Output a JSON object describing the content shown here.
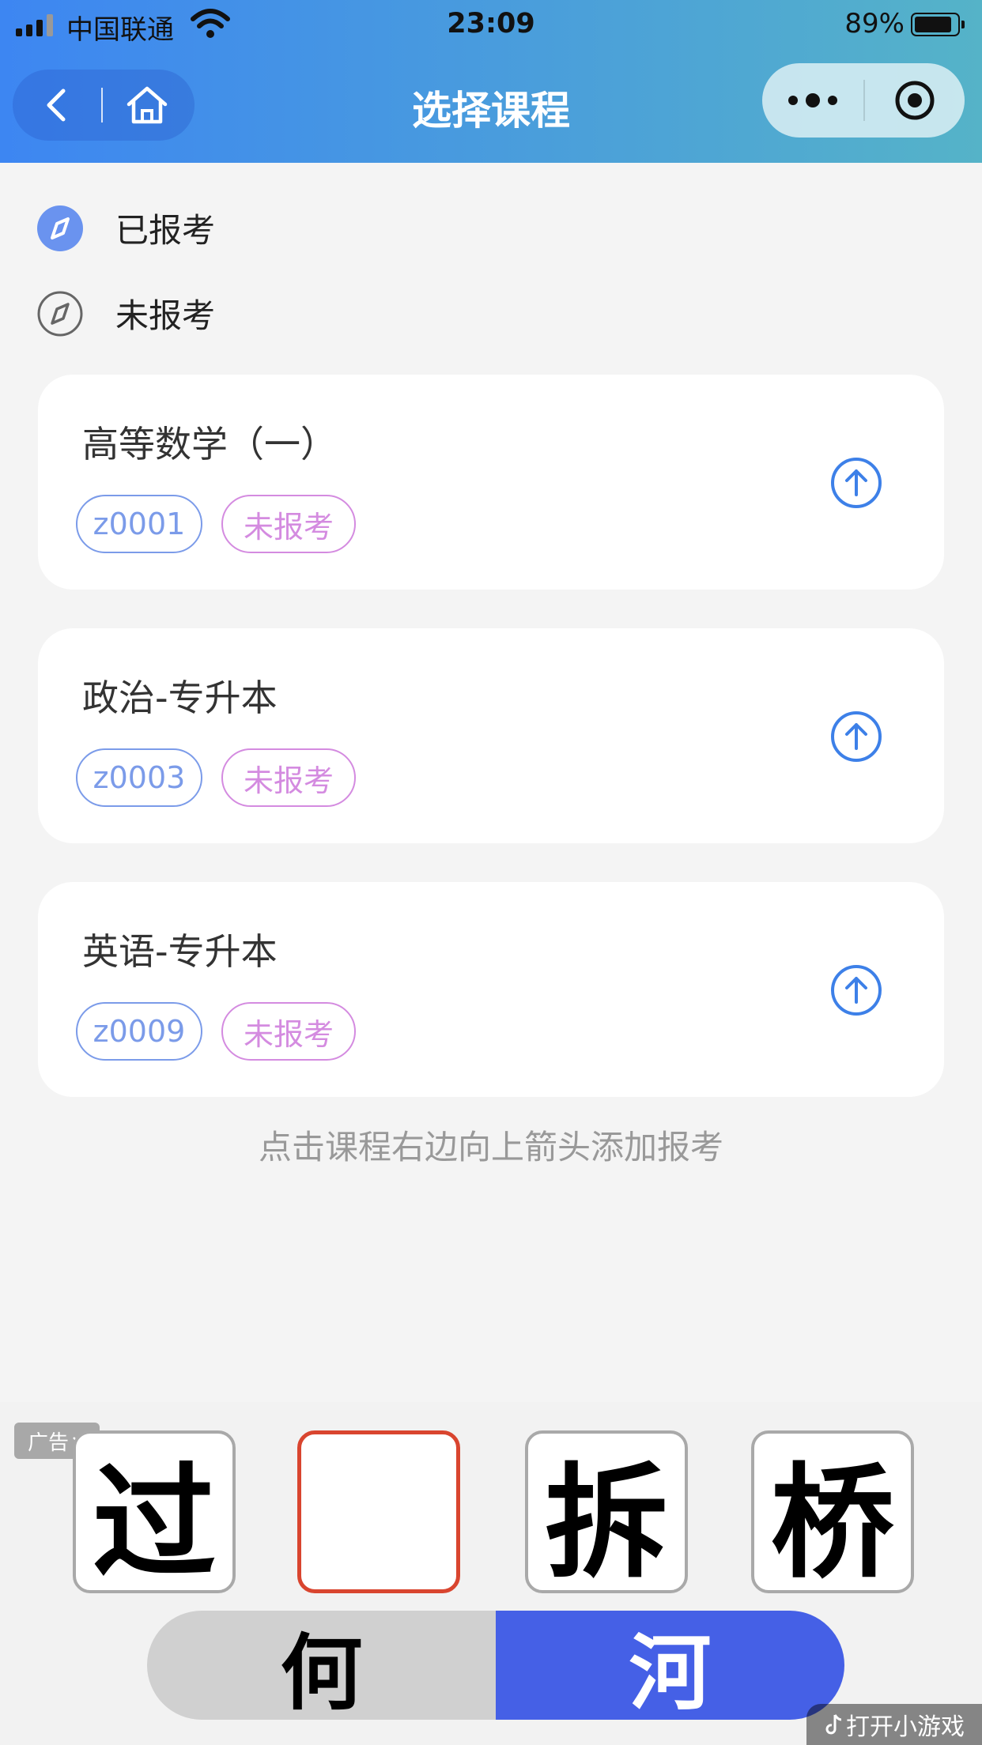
{
  "status_bar": {
    "carrier": "中国联通",
    "time": "23:09",
    "battery_percent": "89%",
    "battery_level": 0.89
  },
  "header": {
    "title": "选择课程"
  },
  "legend": {
    "registered": "已报考",
    "unregistered": "未报考"
  },
  "courses": [
    {
      "name": "高等数学（一）",
      "code": "z0001",
      "status": "未报考"
    },
    {
      "name": "政治-专升本",
      "code": "z0003",
      "status": "未报考"
    },
    {
      "name": "英语-专升本",
      "code": "z0009",
      "status": "未报考"
    }
  ],
  "hint": "点击课程右边向上箭头添加报考",
  "ad": {
    "badge": "广告",
    "tiles": [
      "过",
      "",
      "拆",
      "桥"
    ],
    "options": [
      "何",
      "河"
    ],
    "open_label": "打开小游戏"
  },
  "colors": {
    "primary": "#3d86f2",
    "tag_code": "#7b9be9",
    "tag_status": "#d48be0",
    "option_selected": "#4560e6",
    "tile_highlight": "#d9452f"
  }
}
